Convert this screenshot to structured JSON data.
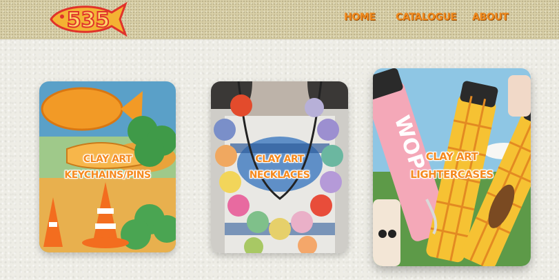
{
  "brand": {
    "logo_text": "535"
  },
  "nav": {
    "items": [
      {
        "label": "HOME"
      },
      {
        "label": "CATALOGUE"
      },
      {
        "label": "ABOUT"
      }
    ]
  },
  "cards": [
    {
      "line1": "CLAY ART",
      "line2": "KEYCHAINS/PINS",
      "image": "clay keychains and pins: orange fish, traffic cones, green clovers"
    },
    {
      "line1": "CLAY ART",
      "line2": "NECKLACES",
      "image": "person wearing colorful clay bead necklace"
    },
    {
      "line1": "CLAY ART",
      "line2": "LIGHTERCASES",
      "image": "painted clay lighter cases, pink and yellow plaid"
    }
  ],
  "colors": {
    "accent": "#f08a1e",
    "header_bg": "#d9d0a8",
    "page_bg": "#eeede6"
  }
}
